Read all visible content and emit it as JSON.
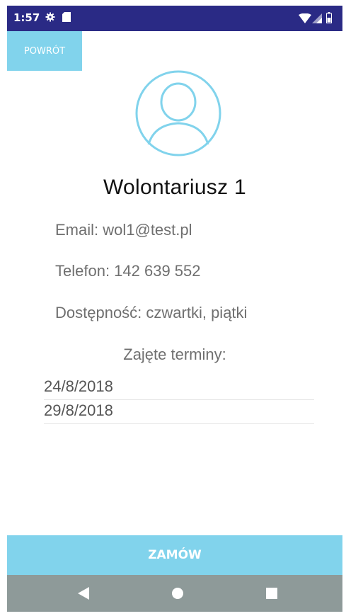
{
  "statusbar": {
    "time": "1:57",
    "icons": [
      "gear-icon",
      "sd-card-icon",
      "wifi-icon",
      "signal-icon",
      "battery-icon"
    ]
  },
  "back_button": {
    "label": "POWRÓT"
  },
  "profile": {
    "avatar_icon": "user-circle-icon",
    "name": "Wolontariusz 1",
    "email": "Email: wol1@test.pl",
    "phone": "Telefon: 142 639 552",
    "availability": "Dostępność: czwartki, piątki"
  },
  "busy": {
    "title": "Zajęte terminy:",
    "dates": [
      "24/8/2018",
      "29/8/2018"
    ]
  },
  "order_button": {
    "label": "ZAMÓW"
  },
  "navbar": {
    "icons": [
      "back-triangle-icon",
      "home-circle-icon",
      "recents-square-icon"
    ]
  },
  "colors": {
    "statusbar": "#2a2a85",
    "accent": "#81d3ec",
    "navbar": "#8e9a99"
  }
}
